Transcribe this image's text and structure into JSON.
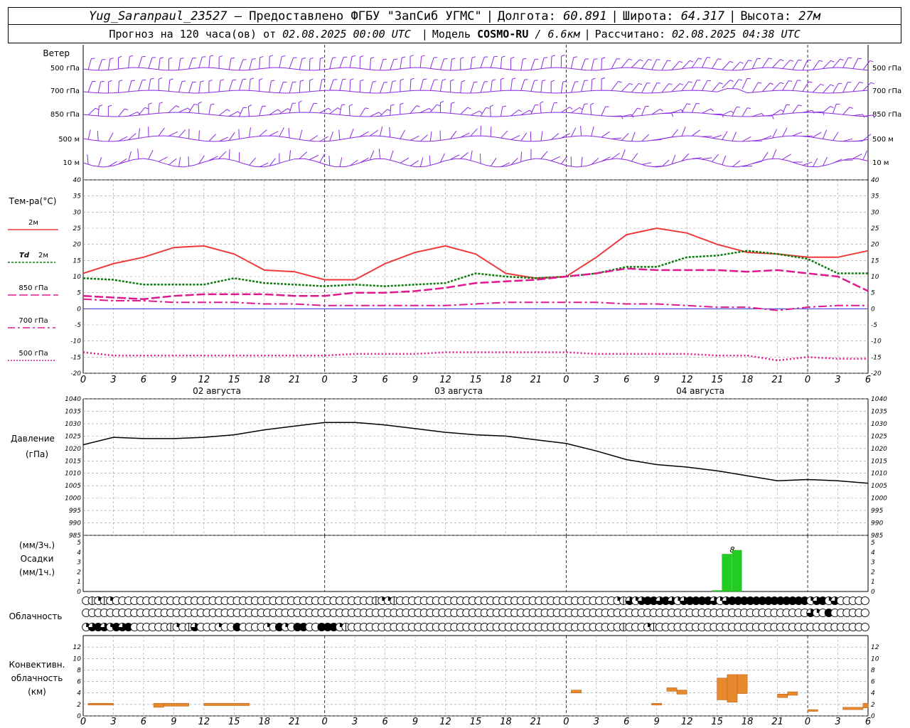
{
  "header": {
    "station": "Yug_Saranpaul_23527",
    "provider": "– Предоставлено ФГБУ \"ЗапСиб УГМС\"",
    "lon_label": "Долгота:",
    "lon": "60.891",
    "lat_label": "Широта:",
    "lat": "64.317",
    "alt_label": "Высота:",
    "alt": "27м",
    "forecast_label": "Прогноз на 120 часа(ов) от",
    "forecast_from": "02.08.2025 00:00 UTC",
    "model_label": "Модель",
    "model": "COSMO-RU",
    "resolution": "/ 6.6км",
    "computed_label": "Рассчитано:",
    "computed": "02.08.2025 04:38 UTC"
  },
  "labels": {
    "wind": "Ветер",
    "wind_levels": [
      "500 гПа",
      "700 гПа",
      "850 гПа",
      "500 м",
      "10 м"
    ],
    "temp": "Тем-ра(°С)",
    "t2m": "2м",
    "td": "Td",
    "td2m": "2м",
    "t850": "850 гПа",
    "t700": "700 гПа",
    "t500": "500 гПа",
    "pressure": "Давление",
    "pressure_unit": "(гПа)",
    "precip_unit1": "(мм/3ч.)",
    "precip": "Осадки",
    "precip_unit2": "(мм/1ч.)",
    "cloud": "Облачность",
    "conv1": "Конвективн.",
    "conv2": "облачность",
    "conv3": "(км)",
    "dates": [
      "02 августа",
      "03 августа",
      "04 августа"
    ],
    "precip_mark": "8"
  },
  "colors": {
    "wind": "#8a2be2",
    "t2m": "#ee3a3a",
    "td": "#0a7a0a",
    "level": "#e01890",
    "pressure": "#000000",
    "precip": "#22cc22",
    "conv": "#e8892d"
  },
  "x_ticks": [
    "0",
    "3",
    "6",
    "9",
    "12",
    "15",
    "18",
    "21",
    "0",
    "3",
    "6",
    "9",
    "12",
    "15",
    "18",
    "21",
    "0",
    "3",
    "6",
    "9",
    "12",
    "15",
    "18",
    "21",
    "0",
    "3",
    "6"
  ],
  "chart_data": [
    {
      "type": "line",
      "title": "Тем-ра(°С)",
      "ylim": [
        -20,
        40
      ],
      "y_ticks": [
        "40",
        "35",
        "30",
        "25",
        "20",
        "15",
        "10",
        "5",
        "0",
        "-5",
        "-10",
        "-15",
        "-20"
      ],
      "x_hours": [
        0,
        3,
        6,
        9,
        12,
        15,
        18,
        21,
        24,
        27,
        30,
        33,
        36,
        39,
        42,
        45,
        48,
        51,
        54,
        57,
        60,
        63,
        66,
        69,
        72,
        75,
        78
      ],
      "series": [
        {
          "name": "2м",
          "values": [
            11,
            14,
            16,
            19,
            19.5,
            17,
            12,
            11.5,
            9,
            9,
            14,
            17.5,
            19.5,
            17,
            11,
            9.5,
            10,
            16,
            23,
            25,
            23.5,
            20,
            17.5,
            17,
            16,
            16,
            18
          ]
        },
        {
          "name": "Td 2м",
          "values": [
            9.5,
            9,
            7.5,
            7.5,
            7.5,
            9.5,
            8,
            7.5,
            7,
            7.5,
            7,
            7.5,
            8,
            11,
            10,
            9.5,
            10,
            11,
            13,
            13,
            16,
            16.5,
            18,
            17,
            15.5,
            11,
            11
          ]
        },
        {
          "name": "850 гПа",
          "values": [
            4,
            3.5,
            3,
            4,
            4.5,
            4.5,
            4.5,
            4,
            4,
            5,
            5,
            5.5,
            6.5,
            8,
            8.5,
            9,
            10,
            11,
            12.5,
            12,
            12,
            12,
            11.5,
            12,
            11,
            10,
            5.5
          ]
        },
        {
          "name": "700 гПа",
          "values": [
            3,
            2.5,
            2.5,
            2,
            2,
            2,
            1.5,
            1.5,
            1,
            1,
            1,
            1,
            1,
            1.5,
            2,
            2,
            2,
            2,
            1.5,
            1.5,
            1,
            0.5,
            0.5,
            -0.5,
            0.5,
            1,
            1
          ]
        },
        {
          "name": "500 гПа",
          "values": [
            -13.5,
            -14.5,
            -14.5,
            -14.5,
            -14.5,
            -14.5,
            -14.5,
            -14.5,
            -14.5,
            -14,
            -14,
            -14,
            -13.5,
            -13.5,
            -13.5,
            -13.5,
            -13.5,
            -14,
            -14,
            -14,
            -14,
            -14.5,
            -14.5,
            -16,
            -15,
            -15.5,
            -15.5
          ]
        }
      ]
    },
    {
      "type": "line",
      "title": "Давление (гПа)",
      "ylim": [
        985,
        1040
      ],
      "y_ticks": [
        "1040",
        "1035",
        "1030",
        "1025",
        "1020",
        "1015",
        "1010",
        "1005",
        "1000",
        "995",
        "990",
        "985"
      ],
      "x_hours": [
        0,
        3,
        6,
        9,
        12,
        15,
        18,
        21,
        24,
        27,
        30,
        33,
        36,
        39,
        42,
        45,
        48,
        51,
        54,
        57,
        60,
        63,
        66,
        69,
        72,
        75,
        78
      ],
      "series": [
        {
          "name": "Давление",
          "values": [
            1021.5,
            1024.5,
            1024,
            1024,
            1024.5,
            1025.5,
            1027.5,
            1029,
            1030.5,
            1030.5,
            1029.5,
            1028,
            1026.5,
            1025.5,
            1025,
            1023.5,
            1022,
            1019,
            1015.5,
            1013.5,
            1012.5,
            1011,
            1009,
            1007,
            1007.5,
            1007,
            1006
          ]
        }
      ]
    },
    {
      "type": "bar",
      "title": "Осадки (мм/3ч.) (мм/1ч.)",
      "ylim": [
        0,
        5
      ],
      "y_ticks": [
        "5",
        "4",
        "3",
        "2",
        "1",
        "0"
      ],
      "bars": [
        {
          "x_hour": 63,
          "value": 0.1
        },
        {
          "x_hour": 64,
          "value": 3.8
        },
        {
          "x_hour": 65,
          "value": 4.2
        }
      ]
    },
    {
      "type": "bar",
      "title": "Конвективн. облачность (км)",
      "ylim": [
        0,
        14
      ],
      "y_ticks": [
        "12",
        "10",
        "8",
        "6",
        "4",
        "2",
        "0"
      ],
      "bars": [
        {
          "x0": 0.5,
          "x1": 3.0,
          "bottom": 1.9,
          "top": 2.2
        },
        {
          "x0": 7.0,
          "x1": 8.0,
          "bottom": 1.5,
          "top": 2.2
        },
        {
          "x0": 8.0,
          "x1": 10.5,
          "bottom": 1.7,
          "top": 2.2
        },
        {
          "x0": 12.0,
          "x1": 16.5,
          "bottom": 1.8,
          "top": 2.2
        },
        {
          "x0": 48.5,
          "x1": 49.5,
          "bottom": 4.0,
          "top": 4.5
        },
        {
          "x0": 56.5,
          "x1": 57.5,
          "bottom": 1.9,
          "top": 2.2
        },
        {
          "x0": 58.0,
          "x1": 59.0,
          "bottom": 4.3,
          "top": 4.9
        },
        {
          "x0": 59.0,
          "x1": 60.0,
          "bottom": 3.8,
          "top": 4.5
        },
        {
          "x0": 63.0,
          "x1": 64.0,
          "bottom": 2.8,
          "top": 6.6
        },
        {
          "x0": 64.0,
          "x1": 65.0,
          "bottom": 2.4,
          "top": 7.2
        },
        {
          "x0": 65.0,
          "x1": 66.0,
          "bottom": 3.9,
          "top": 7.2
        },
        {
          "x0": 69.0,
          "x1": 70.0,
          "bottom": 3.2,
          "top": 3.8
        },
        {
          "x0": 70.0,
          "x1": 71.0,
          "bottom": 3.6,
          "top": 4.2
        },
        {
          "x0": 72.0,
          "x1": 73.0,
          "bottom": 0.8,
          "top": 1.1
        },
        {
          "x0": 75.5,
          "x1": 77.5,
          "bottom": 1.1,
          "top": 1.5
        },
        {
          "x0": 77.5,
          "x1": 78.0,
          "bottom": 1.4,
          "top": 2.2
        }
      ]
    }
  ],
  "cloud_rows": [
    [
      0,
      1,
      2,
      1,
      2,
      0,
      0,
      0,
      0,
      0,
      0,
      0,
      0,
      0,
      0,
      0,
      0,
      0,
      0,
      0,
      0,
      0,
      0,
      0,
      0,
      0,
      0,
      0,
      0,
      0,
      0,
      0,
      0,
      0,
      0,
      0,
      0,
      0,
      0,
      0,
      0,
      0,
      0,
      0,
      0,
      0,
      0,
      0,
      1,
      2,
      2,
      1,
      0,
      0,
      0,
      0,
      0,
      0,
      0,
      0,
      0,
      0,
      0,
      0,
      0,
      0,
      0,
      0,
      0,
      0,
      0,
      0,
      0,
      0,
      0,
      0,
      0,
      0,
      0,
      0,
      0,
      0,
      0,
      0,
      0,
      0,
      0,
      0,
      2,
      1,
      3,
      2,
      3,
      4,
      4,
      3,
      4,
      3,
      2,
      3,
      4,
      4,
      4,
      4,
      3,
      2,
      3,
      4,
      4,
      4,
      4,
      4,
      4,
      4,
      4,
      4,
      4,
      4,
      4,
      4,
      2,
      3,
      4,
      2,
      3,
      0,
      0,
      0,
      0,
      0
    ],
    [
      0,
      0,
      0,
      0,
      0,
      0,
      0,
      0,
      0,
      0,
      0,
      0,
      0,
      0,
      0,
      0,
      0,
      0,
      0,
      0,
      0,
      0,
      0,
      0,
      0,
      0,
      0,
      0,
      0,
      0,
      0,
      0,
      0,
      0,
      0,
      0,
      0,
      0,
      0,
      0,
      0,
      0,
      0,
      0,
      0,
      0,
      0,
      0,
      0,
      0,
      0,
      0,
      0,
      0,
      0,
      0,
      0,
      0,
      0,
      0,
      0,
      0,
      0,
      0,
      0,
      0,
      0,
      0,
      0,
      0,
      0,
      0,
      0,
      0,
      0,
      0,
      0,
      0,
      0,
      0,
      0,
      0,
      0,
      0,
      0,
      0,
      0,
      0,
      0,
      0,
      0,
      0,
      0,
      0,
      0,
      0,
      0,
      0,
      0,
      0,
      0,
      0,
      0,
      0,
      0,
      0,
      0,
      0,
      0,
      0,
      0,
      0,
      0,
      0,
      0,
      0,
      0,
      0,
      0,
      0,
      3,
      2,
      0,
      4,
      0,
      0,
      0,
      0,
      0,
      0
    ],
    [
      2,
      3,
      4,
      3,
      2,
      4,
      3,
      4,
      0,
      0,
      0,
      0,
      0,
      0,
      1,
      2,
      0,
      1,
      3,
      0,
      0,
      0,
      2,
      0,
      0,
      4,
      0,
      0,
      0,
      0,
      2,
      0,
      4,
      2,
      0,
      4,
      4,
      0,
      0,
      4,
      4,
      4,
      2,
      1,
      0,
      0,
      0,
      0,
      0,
      0,
      0,
      0,
      0,
      0,
      0,
      0,
      0,
      0,
      0,
      0,
      0,
      0,
      0,
      0,
      0,
      0,
      0,
      0,
      0,
      0,
      0,
      0,
      0,
      0,
      0,
      0,
      0,
      0,
      0,
      0,
      0,
      0,
      0,
      0,
      0,
      0,
      0,
      0,
      0,
      1,
      0,
      0,
      0,
      2,
      1,
      0,
      0,
      0,
      0,
      0,
      0,
      0,
      0,
      0,
      0,
      0,
      0,
      0,
      0,
      0,
      0,
      0,
      0,
      0,
      0,
      0,
      0,
      0,
      0,
      0,
      0,
      0,
      0,
      0,
      0,
      0,
      0,
      0,
      0,
      0
    ]
  ]
}
